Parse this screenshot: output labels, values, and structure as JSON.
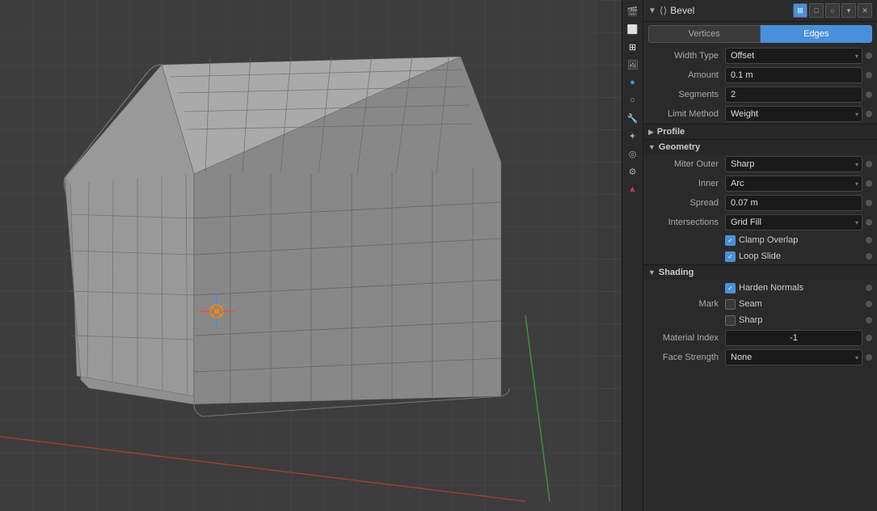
{
  "panel": {
    "title": "Bevel",
    "tabs": [
      {
        "label": "Vertices",
        "active": false
      },
      {
        "label": "Edges",
        "active": true
      }
    ],
    "width_type": {
      "label": "Width Type",
      "value": "Offset"
    },
    "amount": {
      "label": "Amount",
      "value": "0.1 m"
    },
    "segments": {
      "label": "Segments",
      "value": "2"
    },
    "limit_method": {
      "label": "Limit Method",
      "value": "Weight"
    },
    "profile_section": {
      "title": "Profile",
      "collapsed": true
    },
    "geometry_section": {
      "title": "Geometry"
    },
    "miter_outer": {
      "label": "Miter Outer",
      "value": "Sharp"
    },
    "inner": {
      "label": "Inner",
      "value": "Arc"
    },
    "spread": {
      "label": "Spread",
      "value": "0.07 m"
    },
    "intersections": {
      "label": "Intersections",
      "value": "Grid Fill"
    },
    "clamp_overlap": {
      "label": "Clamp Overlap",
      "checked": true
    },
    "loop_slide": {
      "label": "Loop Slide",
      "checked": true
    },
    "shading_section": {
      "title": "Shading"
    },
    "harden_normals": {
      "label": "Harden Normals",
      "checked": true
    },
    "mark": {
      "label": "Mark",
      "seam_label": "Seam",
      "seam_checked": false,
      "sharp_label": "Sharp",
      "sharp_checked": false
    },
    "material_index": {
      "label": "Material Index",
      "value": "-1"
    },
    "face_strength": {
      "label": "Face Strength",
      "value": "None"
    }
  },
  "toolbar": {
    "icons": [
      "🎬",
      "🖼",
      "⊞",
      "🖼",
      "🎨",
      "🌐",
      "🔧",
      "⚙",
      "🌀",
      "🌀",
      "🔴"
    ]
  }
}
